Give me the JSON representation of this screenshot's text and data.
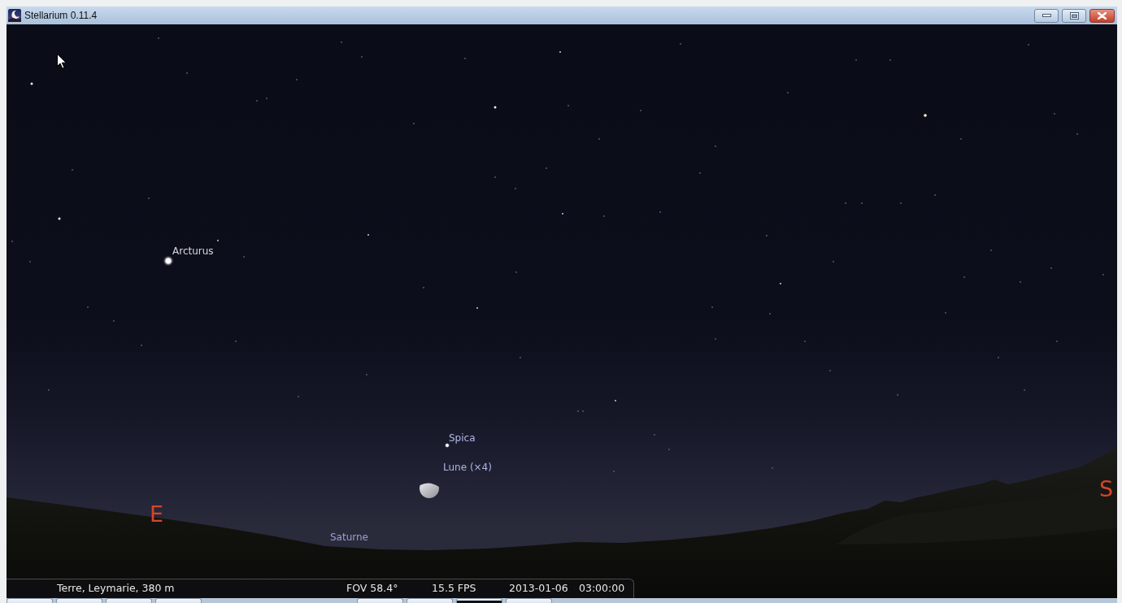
{
  "window": {
    "title": "Stellarium 0.11.4"
  },
  "sky": {
    "objects": [
      {
        "kind": "star",
        "label": "Arcturus"
      },
      {
        "kind": "star",
        "label": "Spica"
      },
      {
        "kind": "moon",
        "label": "Lune (×4)"
      },
      {
        "kind": "planet_below_horizon",
        "label": "Saturne"
      }
    ],
    "cardinal_points": [
      "E",
      "S"
    ]
  },
  "status_bar": {
    "location": "Terre, Leymarie, 380 m",
    "fov": "FOV 58.4°",
    "fps": "15.5 FPS",
    "date": "2013-01-06",
    "time": "03:00:00"
  }
}
